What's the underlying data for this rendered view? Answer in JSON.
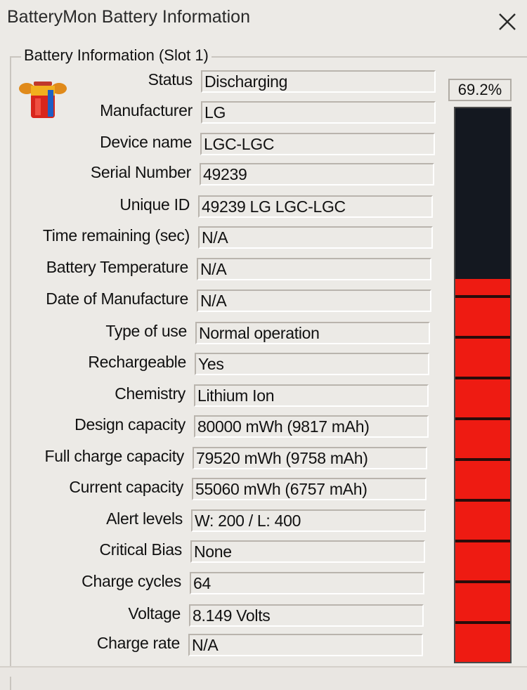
{
  "window": {
    "title": "BatteryMon Battery Information"
  },
  "group": {
    "label": "Battery Information (Slot 1)"
  },
  "gauge": {
    "percent_label": "69.2%",
    "level": 0.692,
    "fill_color": "#ee1b12",
    "empty_color": "#141820"
  },
  "fields": [
    {
      "label": "Status",
      "value": "Discharging"
    },
    {
      "label": "Manufacturer",
      "value": "LG"
    },
    {
      "label": "Device name",
      "value": "LGC-LGC"
    },
    {
      "label": "Serial Number",
      "value": "49239"
    },
    {
      "label": "Unique ID",
      "value": "49239 LG LGC-LGC"
    },
    {
      "label": "Time remaining (sec)",
      "value": "N/A"
    },
    {
      "label": "Battery Temperature",
      "value": "N/A"
    },
    {
      "label": "Date of Manufacture",
      "value": "N/A"
    },
    {
      "label": "Type of use",
      "value": "Normal operation"
    },
    {
      "label": "Rechargeable",
      "value": "Yes"
    },
    {
      "label": "Chemistry",
      "value": "Lithium Ion"
    },
    {
      "label": "Design capacity",
      "value": "80000 mWh (9817 mAh)"
    },
    {
      "label": "Full charge capacity",
      "value": "79520 mWh (9758 mAh)"
    },
    {
      "label": "Current capacity",
      "value": "55060 mWh (6757 mAh)"
    },
    {
      "label": "Alert levels",
      "value": "W: 200 / L: 400"
    },
    {
      "label": "Critical Bias",
      "value": "None"
    },
    {
      "label": "Charge cycles",
      "value": "64"
    },
    {
      "label": "Voltage",
      "value": "8.149 Volts"
    },
    {
      "label": "Charge rate",
      "value": "N/A"
    }
  ]
}
